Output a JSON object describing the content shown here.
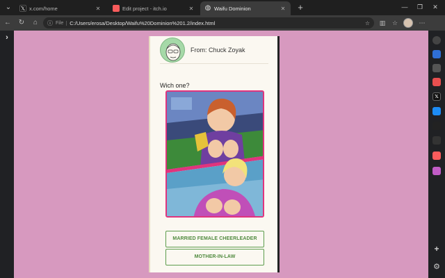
{
  "tabs": [
    {
      "title": "x.com/home",
      "favicon": "x-logo-icon",
      "active": false
    },
    {
      "title": "Edit project - itch.io",
      "favicon": "itchio-icon",
      "active": false
    },
    {
      "title": "Waifu Dominion",
      "favicon": "globe-icon",
      "active": true
    }
  ],
  "address_bar": {
    "scheme_label": "File",
    "url": "C:/Users/erosa/Desktop/Waifu%20Dominion%201.2/index.html"
  },
  "message": {
    "sender": "From: Chuck Zoyak",
    "question": "Wich one?"
  },
  "choices": [
    {
      "label": "MARRIED FEMALE CHEERLEADER"
    },
    {
      "label": "MOTHER-IN-LAW"
    }
  ],
  "colors": {
    "page_background": "#d799bf",
    "choice_border": "#5c9c4c",
    "art_border": "#e0347d"
  }
}
